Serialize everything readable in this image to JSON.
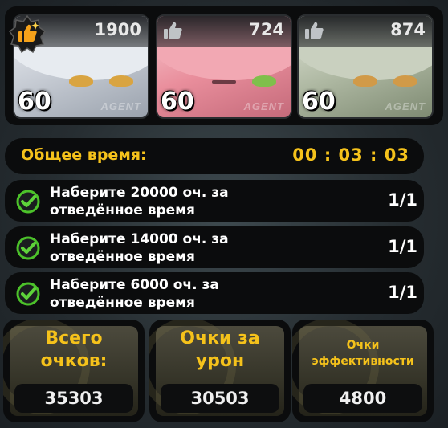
{
  "agents": [
    {
      "likes": "1900",
      "level": "60",
      "tag": "AGENT",
      "hair_color": "#e7ebf0"
    },
    {
      "likes": "724",
      "level": "60",
      "tag": "AGENT",
      "hair_color": "#f2a8b3"
    },
    {
      "likes": "874",
      "level": "60",
      "tag": "AGENT",
      "hair_color": "#c9d0bf"
    }
  ],
  "timer": {
    "label": "Общее время:",
    "value": "00 : 03 : 03"
  },
  "tasks": [
    {
      "line1": "Наберите 20000 оч. за",
      "line2": "отведённое время",
      "progress": "1/1",
      "completed": true
    },
    {
      "line1": "Наберите 14000 оч. за",
      "line2": "отведённое время",
      "progress": "1/1",
      "completed": true
    },
    {
      "line1": "Наберите 6000 оч. за",
      "line2": "отведённое время",
      "progress": "1/1",
      "completed": true
    }
  ],
  "scores": [
    {
      "title_line1": "Всего",
      "title_line2": "очков:",
      "value": "35303"
    },
    {
      "title_line1": "Очки за",
      "title_line2": "урон",
      "value": "30503"
    },
    {
      "title_line1": "Очки",
      "title_line2": "эффективности",
      "value": "4800"
    }
  ],
  "colors": {
    "accent": "#f5c21b",
    "panel": "#0b0c0d",
    "check_green": "#4cc22a"
  }
}
